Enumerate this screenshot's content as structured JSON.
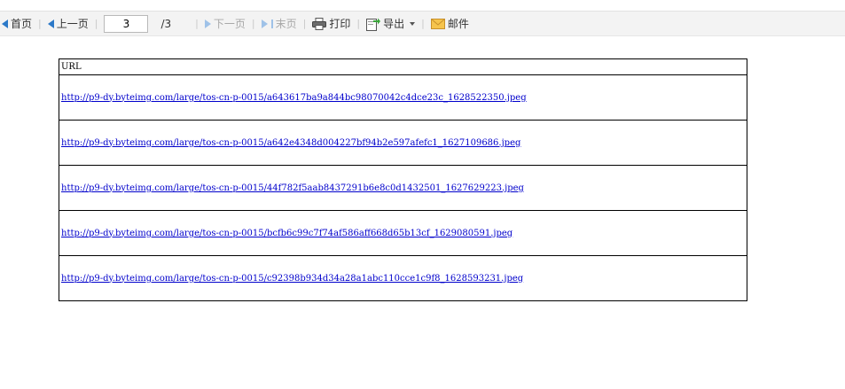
{
  "toolbar": {
    "first_label": "首页",
    "prev_label": "上一页",
    "current_page": "3",
    "total_pages": "/3",
    "next_label": "下一页",
    "last_label": "末页",
    "print_label": "打印",
    "export_label": "导出",
    "mail_label": "邮件"
  },
  "table": {
    "header": "URL",
    "rows": [
      "http://p9-dy.byteimg.com/large/tos-cn-p-0015/a643617ba9a844bc98070042c4dce23c_1628522350.jpeg",
      "http://p9-dy.byteimg.com/large/tos-cn-p-0015/a642e4348d004227bf94b2e597afefc1_1627109686.jpeg",
      "http://p9-dy.byteimg.com/large/tos-cn-p-0015/44f782f5aab8437291b6e8c0d1432501_1627629223.jpeg",
      "http://p9-dy.byteimg.com/large/tos-cn-p-0015/bcfb6c99c7f74af586aff668d65b13cf_1629080591.jpeg",
      "http://p9-dy.byteimg.com/large/tos-cn-p-0015/c92398b934d34a28a1abc110cce1c9f8_1628593231.jpeg"
    ]
  }
}
